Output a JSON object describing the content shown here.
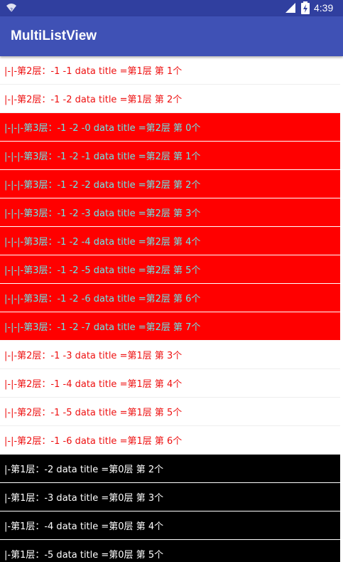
{
  "status_bar": {
    "time": "4:39",
    "wifi_icon": "wifi-icon",
    "signal_icon": "cell-signal-icon",
    "battery_icon": "battery-charging-icon"
  },
  "app_bar": {
    "title": "MultiListView"
  },
  "colors": {
    "status_bar": "#303f9f",
    "app_bar": "#3f51b5",
    "level1_bg": "#000000",
    "level1_text": "#ffffff",
    "level2_bg": "#ffffff",
    "level2_text": "#ee1111",
    "level3_bg": "#ff0000",
    "level3_text": "#6ce6e6"
  },
  "list": {
    "items": [
      {
        "level": 2,
        "text": "|-|-第2层：-1 -1 data title =第1层 第 1个"
      },
      {
        "level": 2,
        "text": "|-|-第2层：-1 -2 data title =第1层 第 2个"
      },
      {
        "level": 3,
        "text": "|-|-|-第3层：-1 -2 -0 data title =第2层 第 0个"
      },
      {
        "level": 3,
        "text": "|-|-|-第3层：-1 -2 -1 data title =第2层 第 1个"
      },
      {
        "level": 3,
        "text": "|-|-|-第3层：-1 -2 -2 data title =第2层 第 2个"
      },
      {
        "level": 3,
        "text": "|-|-|-第3层：-1 -2 -3 data title =第2层 第 3个"
      },
      {
        "level": 3,
        "text": "|-|-|-第3层：-1 -2 -4 data title =第2层 第 4个"
      },
      {
        "level": 3,
        "text": "|-|-|-第3层：-1 -2 -5 data title =第2层 第 5个"
      },
      {
        "level": 3,
        "text": "|-|-|-第3层：-1 -2 -6 data title =第2层 第 6个"
      },
      {
        "level": 3,
        "text": "|-|-|-第3层：-1 -2 -7 data title =第2层 第 7个"
      },
      {
        "level": 2,
        "text": "|-|-第2层：-1 -3 data title =第1层 第 3个"
      },
      {
        "level": 2,
        "text": "|-|-第2层：-1 -4 data title =第1层 第 4个"
      },
      {
        "level": 2,
        "text": "|-|-第2层：-1 -5 data title =第1层 第 5个"
      },
      {
        "level": 2,
        "text": "|-|-第2层：-1 -6 data title =第1层 第 6个"
      },
      {
        "level": 1,
        "text": "|-第1层：-2 data title =第0层 第 2个"
      },
      {
        "level": 1,
        "text": "|-第1层：-3 data title =第0层 第 3个"
      },
      {
        "level": 1,
        "text": "|-第1层：-4 data title =第0层 第 4个"
      },
      {
        "level": 1,
        "text": "|-第1层：-5 data title =第0层 第 5个"
      }
    ]
  }
}
